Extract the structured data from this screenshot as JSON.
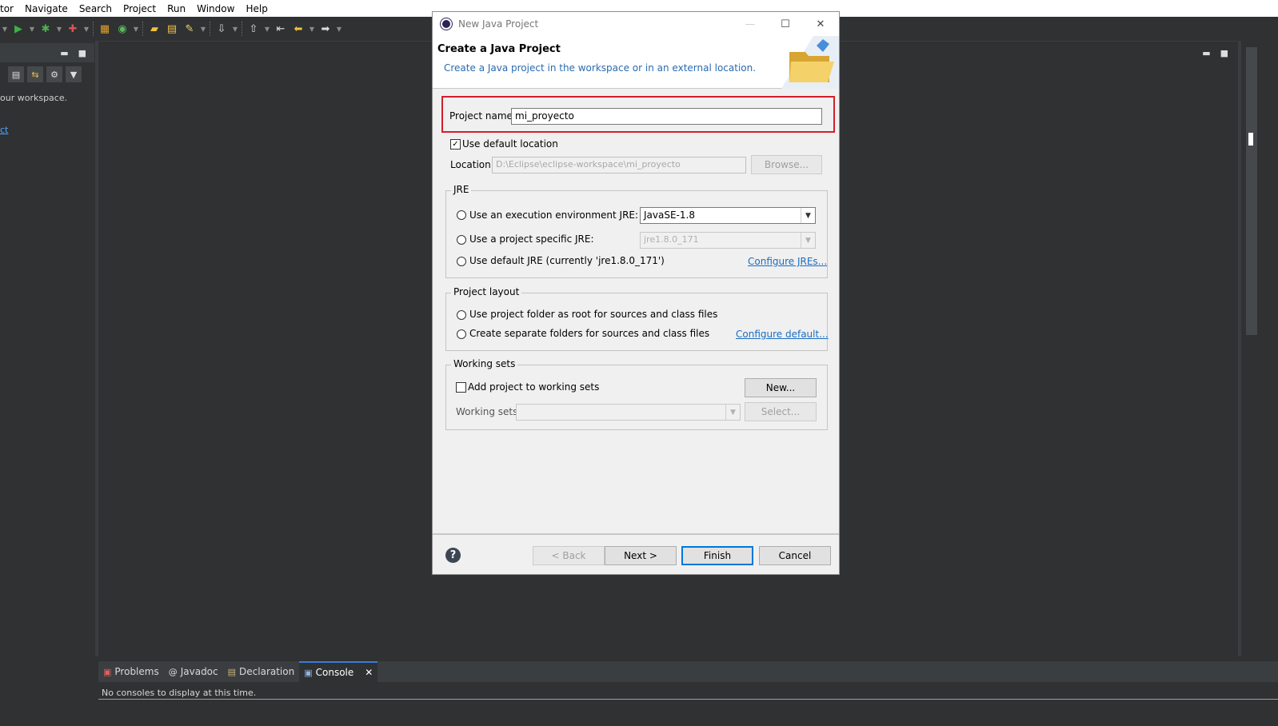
{
  "menubar": {
    "items": [
      "tor",
      "Navigate",
      "Search",
      "Project",
      "Run",
      "Window",
      "Help"
    ]
  },
  "toolbar": {
    "icons": [
      "run-icon",
      "debug-icon",
      "coverage-icon",
      "new-java-package-icon",
      "new-class-icon",
      "open-type-icon",
      "open-task-icon",
      "search-icon",
      "next-annotation-icon",
      "prev-annotation-icon",
      "back-icon",
      "forward-icon"
    ]
  },
  "left_view": {
    "message": "our workspace.",
    "link": "ct"
  },
  "bottom_panel": {
    "tabs": [
      {
        "label": "Problems",
        "icon": "problems-icon"
      },
      {
        "label": "Javadoc",
        "icon": "javadoc-icon"
      },
      {
        "label": "Declaration",
        "icon": "declaration-icon"
      },
      {
        "label": "Console",
        "icon": "console-icon",
        "active": true
      }
    ],
    "console_message": "No consoles to display at this time."
  },
  "dialog": {
    "title": "New Java Project",
    "heading": "Create a Java Project",
    "description": "Create a Java project in the workspace or in an external location.",
    "project_name_label": "Project name:",
    "project_name_value": "mi_proyecto",
    "use_default_location_label": "Use default location",
    "use_default_location_checked": true,
    "location_label": "Location:",
    "location_value": "D:\\Eclipse\\eclipse-workspace\\mi_proyecto",
    "browse_label": "Browse...",
    "jre_group": {
      "title": "JRE",
      "option_exec_env": "Use an execution environment JRE:",
      "exec_env_value": "JavaSE-1.8",
      "option_project_specific": "Use a project specific JRE:",
      "project_specific_value": "jre1.8.0_171",
      "option_default": "Use default JRE (currently 'jre1.8.0_171')",
      "configure_link": "Configure JREs..."
    },
    "layout_group": {
      "title": "Project layout",
      "option_root": "Use project folder as root for sources and class files",
      "option_separate": "Create separate folders for sources and class files",
      "configure_link": "Configure default..."
    },
    "working_sets_group": {
      "title": "Working sets",
      "add_label": "Add project to working sets",
      "new_button": "New...",
      "working_sets_label": "Working sets:",
      "select_button": "Select..."
    },
    "buttons": {
      "back": "< Back",
      "next": "Next >",
      "finish": "Finish",
      "cancel": "Cancel"
    },
    "highlight_color": "#d21f2b"
  }
}
